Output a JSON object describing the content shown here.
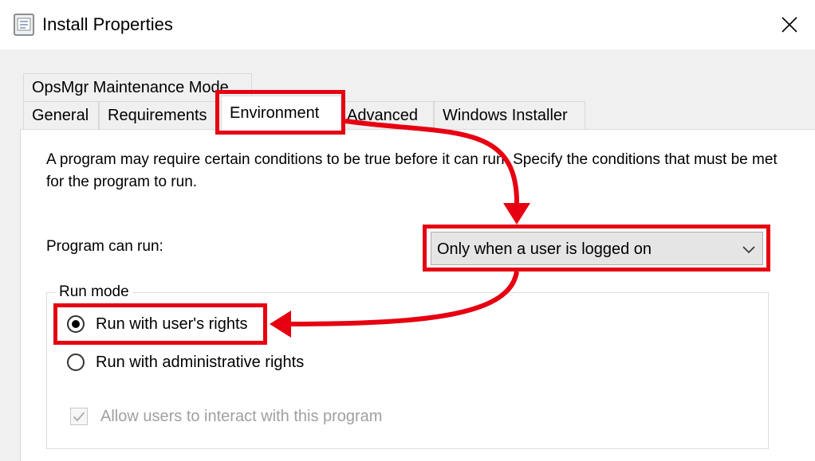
{
  "window": {
    "title": "Install Properties",
    "icon": "properties-sheet-icon",
    "close_icon": "close-icon"
  },
  "tabs": {
    "row_back": [
      {
        "label": "OpsMgr Maintenance Mode"
      }
    ],
    "row_front": [
      {
        "label": "General"
      },
      {
        "label": "Requirements"
      },
      {
        "label": "Environment",
        "selected": true
      },
      {
        "label": "Advanced"
      },
      {
        "label": "Windows Installer"
      }
    ]
  },
  "environment": {
    "description": "A program may require certain conditions to be true before it can run. Specify the conditions that must be met for the program to run.",
    "program_can_run_label": "Program can run:",
    "program_can_run_value": "Only when a user is logged on",
    "run_mode": {
      "label": "Run mode",
      "options": [
        {
          "label": "Run with user's rights",
          "checked": true
        },
        {
          "label": "Run with administrative rights",
          "checked": false
        }
      ]
    },
    "allow_interact": {
      "label": "Allow users to interact with this program",
      "checked": true,
      "disabled": true
    }
  },
  "annotation": {
    "highlight_color": "#e60012"
  }
}
